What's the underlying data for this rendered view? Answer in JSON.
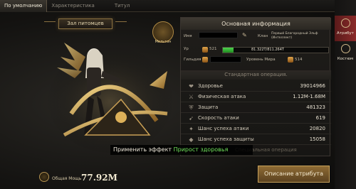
{
  "tabs": [
    "По умолчанию",
    "Характеристика",
    "Титул"
  ],
  "banner": "Зал питомцев",
  "emblem_label": "Мельтон",
  "power": {
    "label": "Общая Мощь",
    "value": "77.92M"
  },
  "panel": {
    "title": "Основная информация",
    "name_label": "Имя",
    "clan_label": "Клан",
    "clan_name": "Первый Благородный Эльф (Интеллект)",
    "level_label": "Ур",
    "level_value": "521",
    "level_progress": 0.1,
    "exp_text": "81.322T/811.264T",
    "guild_label": "Гильдия",
    "world_label": "Уровень Мира",
    "world_value": "514"
  },
  "section_standard": "Стандартная операция.",
  "stats": [
    {
      "icon": "heart-icon",
      "name": "Здоровье",
      "value": "39014966"
    },
    {
      "icon": "sword-icon",
      "name": "Физическая атака",
      "value": "1.12M-1.68M"
    },
    {
      "icon": "shield-icon",
      "name": "Защита",
      "value": "481323"
    },
    {
      "icon": "speed-icon",
      "name": "Скорость атаки",
      "value": "619"
    },
    {
      "icon": "crit-icon",
      "name": "Шанс успеха атаки",
      "value": "20820"
    },
    {
      "icon": "block-icon",
      "name": "Шанс успеха защиты",
      "value": "15058"
    }
  ],
  "tooltip": {
    "prefix": "Применить эффект",
    "highlight": "Прирост здоровья"
  },
  "section_special": "Специальная операция",
  "description_button": "Описание атрибута",
  "rail": [
    {
      "label": "Атрибут",
      "icon": "attribute-icon"
    },
    {
      "label": "Костюм",
      "icon": "costume-icon"
    }
  ],
  "colors": {
    "accent": "#c7a15b",
    "exp_fill": "#4fd54f",
    "highlight": "#6fe15a",
    "rail_active": "#8a2a2a"
  }
}
